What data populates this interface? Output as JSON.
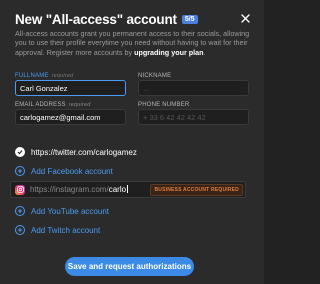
{
  "modal": {
    "title": "New \"All-access\" account",
    "badge": "5/5",
    "description": "All-access accounts grant you permanent access to their socials, allowing you to use their profile everytime you need without having to wait for their approval. Register more accounts by",
    "upgrade_link": "upgrading your plan",
    "description_end": "."
  },
  "form": {
    "fullname": {
      "label": "Fullname",
      "required": "required",
      "value": "Carl Gonzalez"
    },
    "nickname": {
      "label": "Nickname",
      "value": "",
      "placeholder": "..."
    },
    "email": {
      "label": "Email address",
      "required": "required",
      "value": "carlogamez@gmail.com"
    },
    "phone": {
      "label": "Phone number",
      "value": "",
      "placeholder": "+ 33 6 42 42 42 42"
    }
  },
  "socials": {
    "twitter": {
      "value": "https://twitter.com/carlogamez"
    },
    "facebook_add": "Add Facebook account",
    "instagram": {
      "prefix": "https://instagram.com/",
      "typed": "carlo",
      "badge": "Business account required"
    },
    "youtube_add": "Add YouTube account",
    "twitch_add": "Add Twitch account"
  },
  "submit_label": "Save and request authorizations",
  "colors": {
    "accent": "#3b8be6",
    "background": "#2b2b2b",
    "warning": "#e07d3a"
  },
  "icons": [
    "close-icon",
    "check-icon",
    "plus-icon",
    "instagram-icon"
  ]
}
